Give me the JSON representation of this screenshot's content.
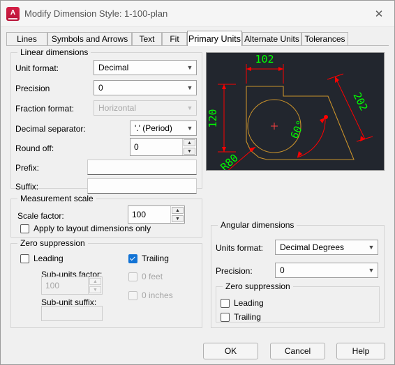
{
  "window": {
    "title": "Modify Dimension Style: 1-100-plan",
    "app_icon": "autocad-icon",
    "close_icon": "✕"
  },
  "tabs": [
    {
      "label": "Lines",
      "active": false
    },
    {
      "label": "Symbols and Arrows",
      "active": false
    },
    {
      "label": "Text",
      "active": false
    },
    {
      "label": "Fit",
      "active": false
    },
    {
      "label": "Primary Units",
      "active": true
    },
    {
      "label": "Alternate Units",
      "active": false
    },
    {
      "label": "Tolerances",
      "active": false
    }
  ],
  "linear_dimensions": {
    "legend": "Linear dimensions",
    "unit_format": {
      "label": "Unit format:",
      "value": "Decimal"
    },
    "precision": {
      "label": "Precision",
      "value": "0"
    },
    "fraction_format": {
      "label": "Fraction format:",
      "value": "Horizontal",
      "disabled": true
    },
    "decimal_separator": {
      "label": "Decimal separator:",
      "value": "'.' (Period)"
    },
    "round_off": {
      "label": "Round off:",
      "value": "0"
    },
    "prefix": {
      "label": "Prefix:",
      "value": ""
    },
    "suffix": {
      "label": "Suffix:",
      "value": ""
    }
  },
  "measurement_scale": {
    "legend": "Measurement scale",
    "scale_factor": {
      "label": "Scale factor:",
      "value": "100"
    },
    "apply_layout_only": {
      "label": "Apply to layout dimensions only",
      "checked": false
    }
  },
  "zero_suppression_linear": {
    "legend": "Zero suppression",
    "leading": {
      "label": "Leading",
      "checked": false
    },
    "trailing": {
      "label": "Trailing",
      "checked": true
    },
    "sub_units_factor": {
      "label": "Sub-units factor:",
      "value": "100",
      "disabled": true
    },
    "sub_unit_suffix": {
      "label": "Sub-unit suffix:",
      "value": "",
      "disabled": true
    },
    "zero_feet": {
      "label": "0 feet",
      "checked": false,
      "disabled": true
    },
    "zero_inches": {
      "label": "0 inches",
      "checked": false,
      "disabled": true
    }
  },
  "angular_dimensions": {
    "legend": "Angular dimensions",
    "units_format": {
      "label": "Units format:",
      "value": "Decimal Degrees"
    },
    "precision": {
      "label": "Precision:",
      "value": "0"
    },
    "zero_suppression": {
      "legend": "Zero suppression",
      "leading": {
        "label": "Leading",
        "checked": false
      },
      "trailing": {
        "label": "Trailing",
        "checked": false
      }
    }
  },
  "preview": {
    "name": "dimension-style-preview",
    "background": "#22262e",
    "geometry_color": "#c8912b",
    "dimension_color": "#ff0000",
    "text_color": "#00ff00",
    "labels": {
      "top_horizontal": "102",
      "left_vertical": "120",
      "diagonal": "202",
      "angular": "60°",
      "radius": "R80"
    }
  },
  "buttons": {
    "ok": "OK",
    "cancel": "Cancel",
    "help": "Help"
  }
}
